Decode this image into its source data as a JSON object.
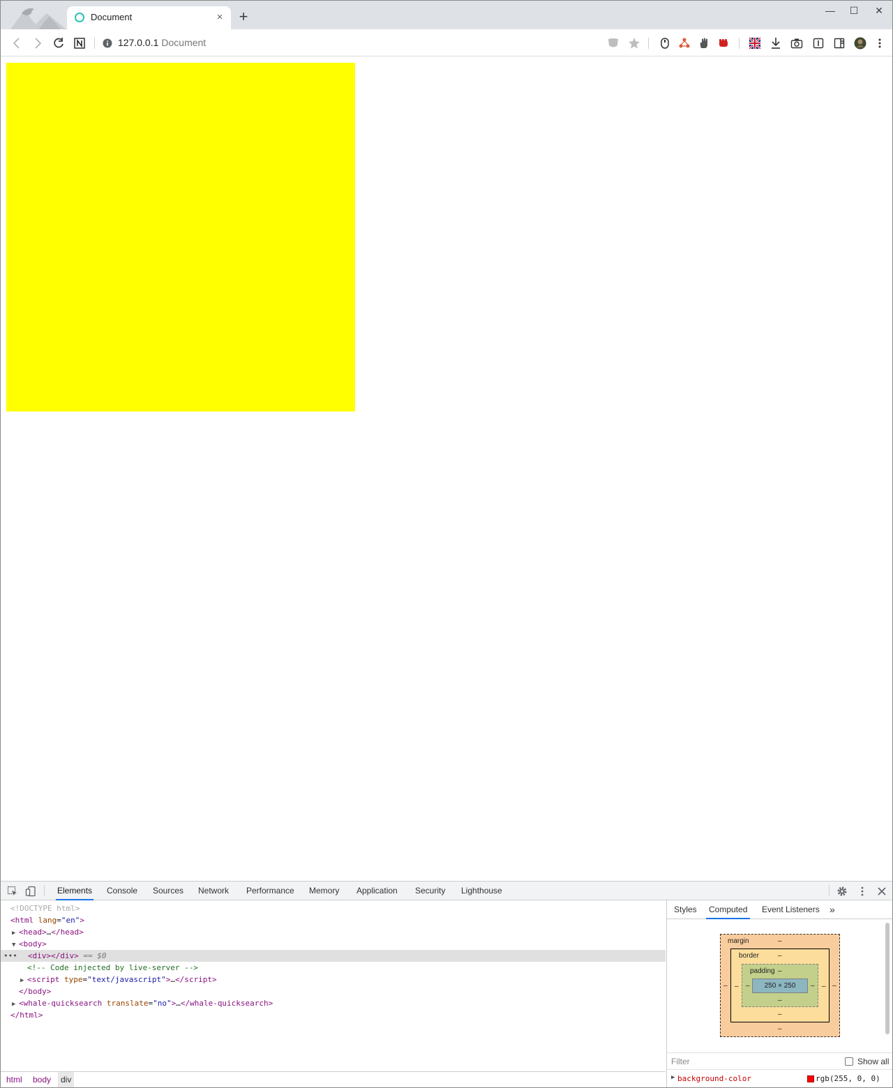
{
  "browser": {
    "tab_title": "Document",
    "tab_close": "×",
    "new_tab": "+",
    "window_controls": {
      "minimize": "—",
      "maximize": "☐",
      "close": "✕"
    },
    "nav_icons": [
      "back-icon",
      "forward-icon",
      "reload-icon",
      "notion-icon"
    ],
    "address": {
      "host": "127.0.0.1",
      "page_title": "Document"
    },
    "extension_icons": [
      "shield-icon",
      "star-icon",
      "mouse-icon",
      "network-icon",
      "hand-icon",
      "fist-icon",
      "uk-flag-icon",
      "download-icon",
      "camera-icon",
      "reader-icon",
      "sidebar-icon",
      "profile-avatar-icon",
      "menu-icon"
    ]
  },
  "page": {
    "box_color": "#ffff00"
  },
  "devtools": {
    "tabs": [
      "Elements",
      "Console",
      "Sources",
      "Network",
      "Performance",
      "Memory",
      "Application",
      "Security",
      "Lighthouse"
    ],
    "active_tab": "Elements",
    "dom": {
      "doctype": "<!DOCTYPE html>",
      "html_open": "html",
      "html_attr": "lang",
      "html_attr_val": "\"en\"",
      "head": "head",
      "head_ellipsis": "…",
      "body": "body",
      "div": "div",
      "sel_marker": " == $0",
      "comment": "<!-- Code injected by live-server -->",
      "script": "script",
      "script_attr": "type",
      "script_attr_val": "\"text/javascript\"",
      "ellipsis": "…",
      "whale": "whale-quicksearch",
      "whale_attr": "translate",
      "whale_attr_val": "\"no\""
    },
    "breadcrumb": [
      "html",
      "body",
      "div"
    ],
    "side_tabs": [
      "Styles",
      "Computed",
      "Event Listeners"
    ],
    "side_more": "»",
    "box_model": {
      "margin_label": "margin",
      "border_label": "border",
      "padding_label": "padding",
      "dash": "–",
      "content_size": "250 × 250"
    },
    "filter_placeholder": "Filter",
    "show_all_label": "Show all",
    "computed_property": {
      "name": "background-color",
      "value": "rgb(255, 0, 0)",
      "swatch": "#ff0000"
    }
  }
}
